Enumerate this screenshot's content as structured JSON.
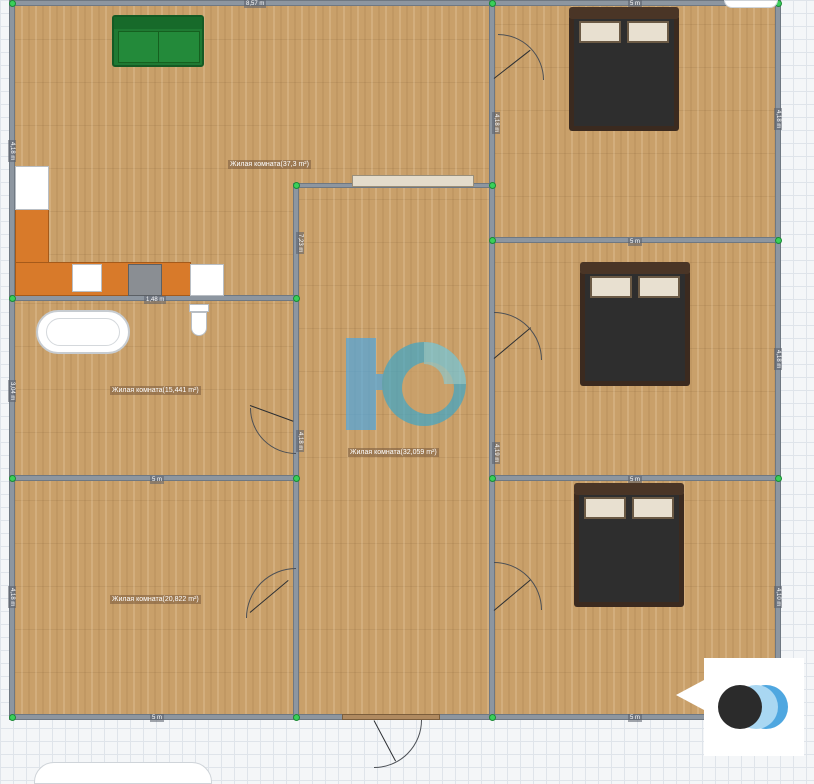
{
  "plan": {
    "rooms": [
      {
        "id": "living-top",
        "label": "Жилая комната(37,3 m²)"
      },
      {
        "id": "bath-room",
        "label": "Жилая комната(15,441 m²)"
      },
      {
        "id": "left-bottom",
        "label": "Жилая комната(20,822 m²)"
      },
      {
        "id": "center",
        "label": "Жилая комната(32,059 m²)"
      }
    ],
    "dimensions": {
      "top_left": "8,57 m",
      "top_right": "5 m",
      "right_wall_1": "4,18 m",
      "right_wall_2": "4,18 m",
      "right_wall_3": "4,10 m",
      "mid_right_1": "5 m",
      "mid_right_2": "5 m",
      "bottom_left": "5 m",
      "bottom_right": "5 m",
      "left_wall_1": "4,18 m",
      "left_wall_2": "3,04 m",
      "left_wall_3": "4,18 m",
      "mid_left": "5 m",
      "inner_1": "4,18 m",
      "inner_2": "7,23 m",
      "inner_3": "4,18 m",
      "inner_4": "4,19 m",
      "kitchen": "1,48 m"
    },
    "furniture": [
      "sofa",
      "bed",
      "bed",
      "bed",
      "bathtub",
      "toilet",
      "kitchen-counter"
    ],
    "colors": {
      "floor": "#c9a06a",
      "wall": "#8d96a0",
      "node": "#3ad05a",
      "sofa": "#1f7a33",
      "counter": "#d87a2a",
      "logo_blue": "#4fa7e0",
      "logo_dark": "#2b2b2b"
    }
  }
}
